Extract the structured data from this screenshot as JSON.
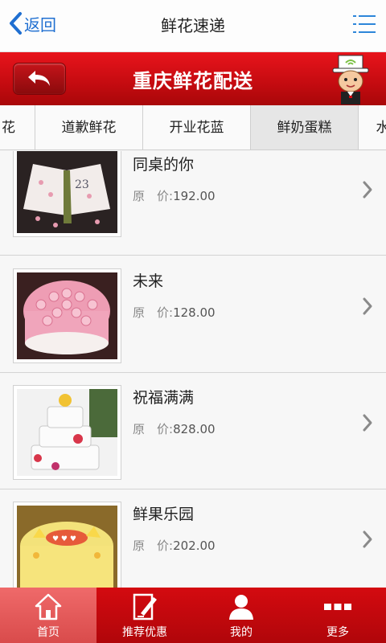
{
  "topbar": {
    "back_label": "返回",
    "title": "鲜花速递"
  },
  "banner": {
    "title": "重庆鲜花配送"
  },
  "tabs": [
    {
      "label": "花"
    },
    {
      "label": "道歉鲜花"
    },
    {
      "label": "开业花蓝"
    },
    {
      "label": "鲜奶蛋糕",
      "active": true
    },
    {
      "label": "水"
    }
  ],
  "products": [
    {
      "name": "同桌的你",
      "price_label": "原　价:",
      "price": "192.00"
    },
    {
      "name": "未来",
      "price_label": "原　价:",
      "price": "128.00"
    },
    {
      "name": "祝福满满",
      "price_label": "原　价:",
      "price": "828.00"
    },
    {
      "name": "鲜果乐园",
      "price_label": "原　价:",
      "price": "202.00"
    }
  ],
  "bottom_nav": [
    {
      "label": "首页",
      "icon": "home-icon",
      "active": true
    },
    {
      "label": "推荐优惠",
      "icon": "edit-icon"
    },
    {
      "label": "我的",
      "icon": "user-icon"
    },
    {
      "label": "更多",
      "icon": "more-icon"
    }
  ],
  "colors": {
    "accent_red": "#d40a10",
    "link_blue": "#1f6fd1"
  }
}
